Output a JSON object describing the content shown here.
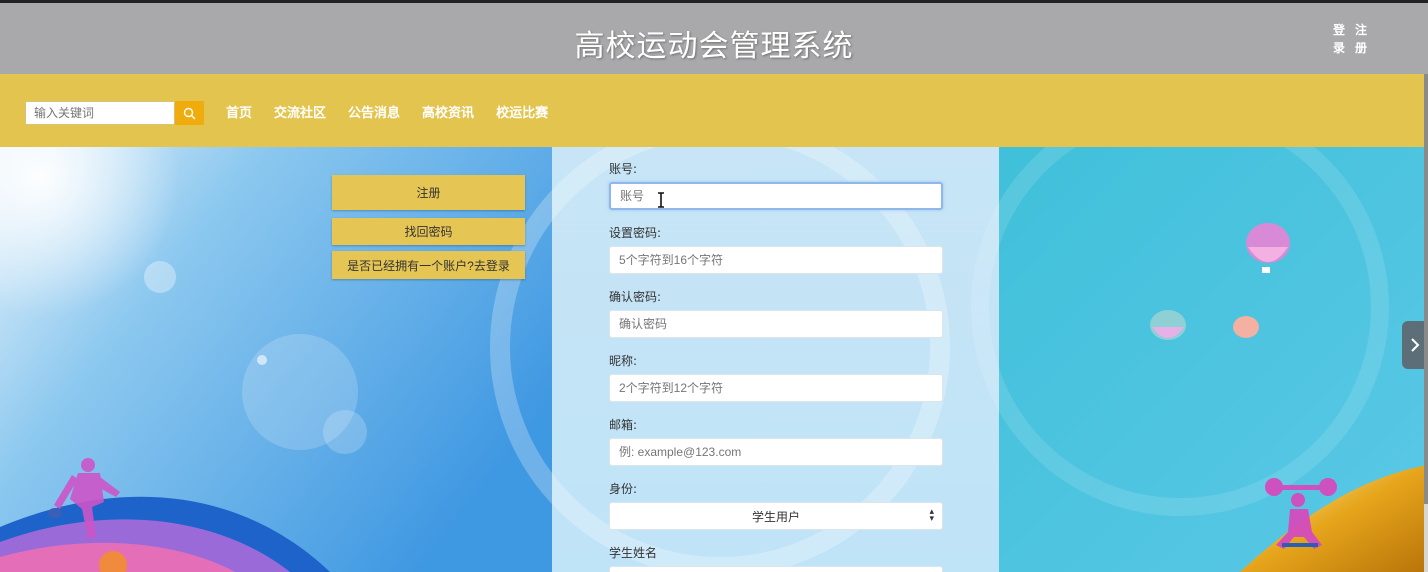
{
  "header": {
    "title": "高校运动会管理系统",
    "auth_links": [
      "登",
      "注",
      "录",
      "册"
    ]
  },
  "navbar": {
    "search_placeholder": "输入关键词",
    "links": [
      "首页",
      "交流社区",
      "公告消息",
      "高校资讯",
      "校运比赛"
    ]
  },
  "left_actions": {
    "register": "注册",
    "find_password": "找回密码",
    "have_account": "是否已经拥有一个账户?去登录"
  },
  "form": {
    "account_label": "账号:",
    "account_placeholder": "账号",
    "password_label": "设置密码:",
    "password_placeholder": "5个字符到16个字符",
    "confirm_label": "确认密码:",
    "confirm_placeholder": "确认密码",
    "nickname_label": "昵称:",
    "nickname_placeholder": "2个字符到12个字符",
    "email_label": "邮箱:",
    "email_placeholder": "例: example@123.com",
    "role_label": "身份:",
    "role_value": "学生用户",
    "student_name_label": "学生姓名"
  },
  "colors": {
    "header_bg": "#a9a9ab",
    "navbar_bg": "#e3c44f",
    "search_button": "#f0ab0c",
    "action_button": "#e5c553"
  },
  "icons": {
    "search": "search-icon",
    "next": "chevron-right-icon"
  }
}
